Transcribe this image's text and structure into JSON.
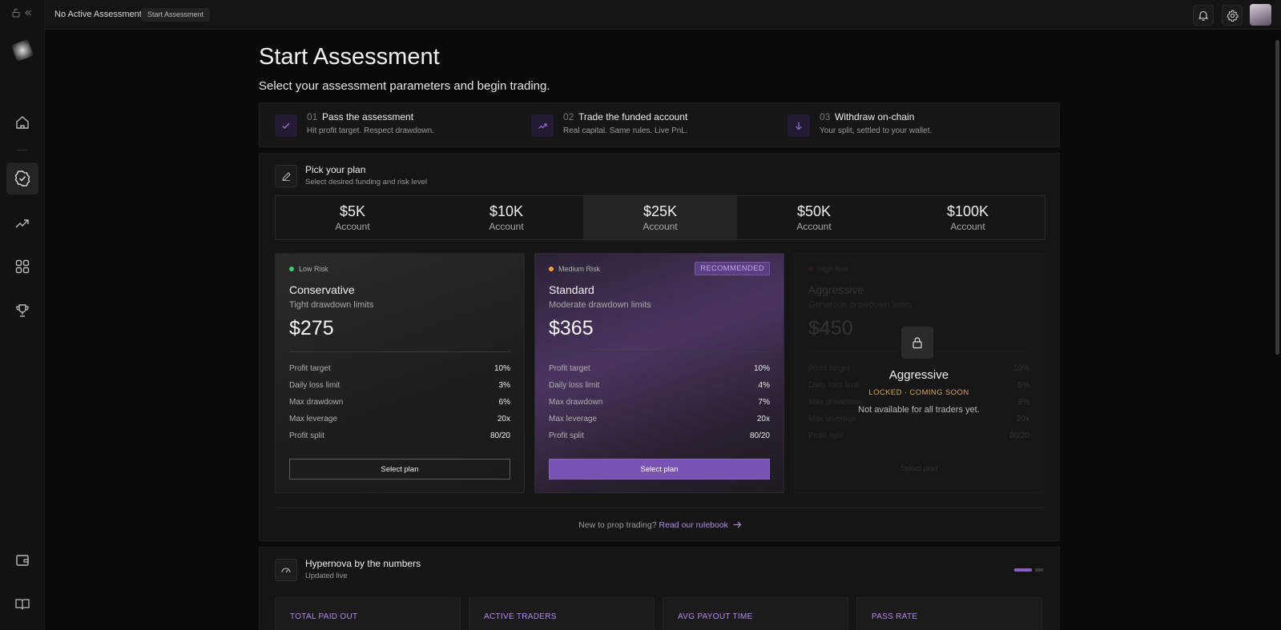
{
  "topbar": {
    "title": "No Active Assessment",
    "crumb": "Start Assessment"
  },
  "page": {
    "title": "Start Assessment",
    "subtitle": "Select your assessment parameters and begin trading."
  },
  "steps": [
    {
      "num": "01",
      "title": "Pass the assessment",
      "desc": "Hit profit target. Respect drawdown.",
      "icon": "check-icon"
    },
    {
      "num": "02",
      "title": "Trade the funded account",
      "desc": "Real capital. Same rules. Live PnL.",
      "icon": "trending-up-icon"
    },
    {
      "num": "03",
      "title": "Withdraw on-chain",
      "desc": "Your split, settled to your wallet.",
      "icon": "arrow-down-icon"
    }
  ],
  "plan": {
    "title": "Pick your plan",
    "subtitle": "Select desired funding and risk level",
    "accounts": [
      {
        "amount": "$5K",
        "label": "Account"
      },
      {
        "amount": "$10K",
        "label": "Account"
      },
      {
        "amount": "$25K",
        "label": "Account"
      },
      {
        "amount": "$50K",
        "label": "Account"
      },
      {
        "amount": "$100K",
        "label": "Account"
      }
    ],
    "selected_account": "$25K",
    "cards": [
      {
        "risk": "Low Risk",
        "risk_color": "#3ecf6e",
        "name": "Conservative",
        "desc": "Tight drawdown limits",
        "price": "$275",
        "rows": [
          {
            "k": "Profit target",
            "v": "10%"
          },
          {
            "k": "Daily loss limit",
            "v": "3%"
          },
          {
            "k": "Max drawdown",
            "v": "6%"
          },
          {
            "k": "Max leverage",
            "v": "20x"
          },
          {
            "k": "Profit split",
            "v": "80/20"
          }
        ],
        "button": "Select plan"
      },
      {
        "risk": "Medium Risk",
        "risk_color": "#f0a030",
        "badge": "RECOMMENDED",
        "name": "Standard",
        "desc": "Moderate drawdown limits",
        "price": "$365",
        "rows": [
          {
            "k": "Profit target",
            "v": "10%"
          },
          {
            "k": "Daily loss limit",
            "v": "4%"
          },
          {
            "k": "Max drawdown",
            "v": "7%"
          },
          {
            "k": "Max leverage",
            "v": "20x"
          },
          {
            "k": "Profit split",
            "v": "80/20"
          }
        ],
        "button": "Select plan"
      },
      {
        "risk": "High Risk",
        "risk_color": "#e04040",
        "name": "Aggressive",
        "desc": "Generous drawdown limits",
        "price": "$450",
        "rows": [
          {
            "k": "Profit target",
            "v": "10%"
          },
          {
            "k": "Daily loss limit",
            "v": "5%"
          },
          {
            "k": "Max drawdown",
            "v": "8%"
          },
          {
            "k": "Max leverage",
            "v": "20x"
          },
          {
            "k": "Profit split",
            "v": "80/20"
          }
        ],
        "button": "Select plan",
        "locked_title": "Aggressive",
        "locked_status": "LOCKED · COMING SOON",
        "locked_note": "Not available for all traders yet."
      }
    ],
    "footer_text": "New to prop trading?",
    "footer_link": "Read our rulebook"
  },
  "stats": {
    "title": "Hypernova by the numbers",
    "subtitle": "Updated live",
    "items": [
      {
        "label": "TOTAL PAID OUT"
      },
      {
        "label": "ACTIVE TRADERS"
      },
      {
        "label": "AVG PAYOUT TIME"
      },
      {
        "label": "PASS RATE"
      }
    ]
  },
  "colors": {
    "accent": "#7a52b3",
    "accent_text": "#b388ee",
    "warning": "#d8a54a"
  }
}
